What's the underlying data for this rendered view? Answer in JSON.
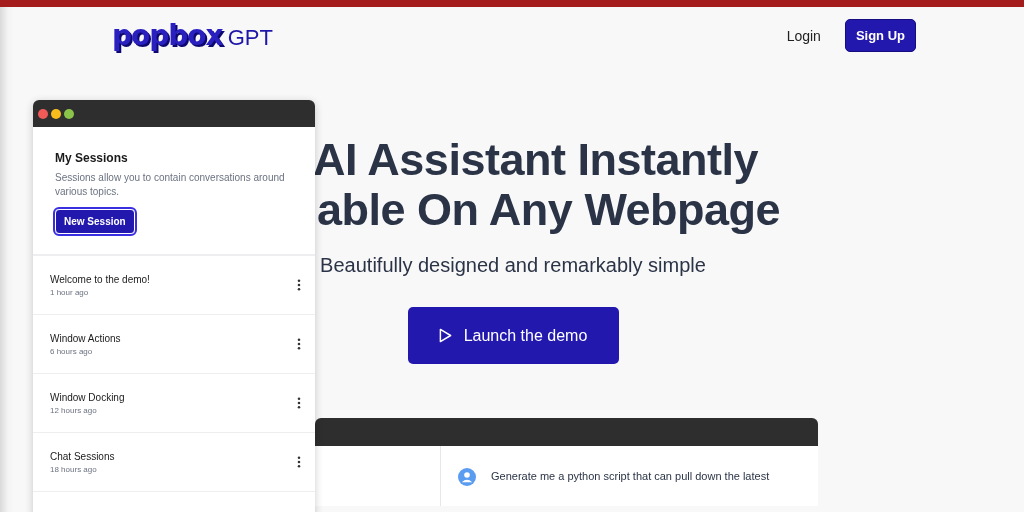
{
  "header": {
    "logo": {
      "word": "popbox",
      "suffix": "GPT"
    },
    "nav": [
      {
        "label": "Login",
        "kind": "link"
      },
      {
        "label": "Sign Up",
        "kind": "button"
      }
    ]
  },
  "hero": {
    "headline_lines": [
      "AI Assistant Instantly",
      "able On Any Webpage"
    ],
    "subtitle": "Beautifully designed and remarkably simple",
    "cta": "Launch the demo"
  },
  "sessions_window": {
    "title": "My Sessions",
    "description": "Sessions allow you to contain conversations around various topics.",
    "new_button": "New Session",
    "sessions": [
      {
        "name": "Welcome to the demo!",
        "time": "1 hour ago"
      },
      {
        "name": "Window Actions",
        "time": "6 hours ago"
      },
      {
        "name": "Window Docking",
        "time": "12 hours ago"
      },
      {
        "name": "Chat Sessions",
        "time": "18 hours ago"
      }
    ]
  },
  "chat_window": {
    "messages": [
      {
        "kind": "user",
        "text": "Generate me a python script that can pull down the latest"
      }
    ]
  }
}
